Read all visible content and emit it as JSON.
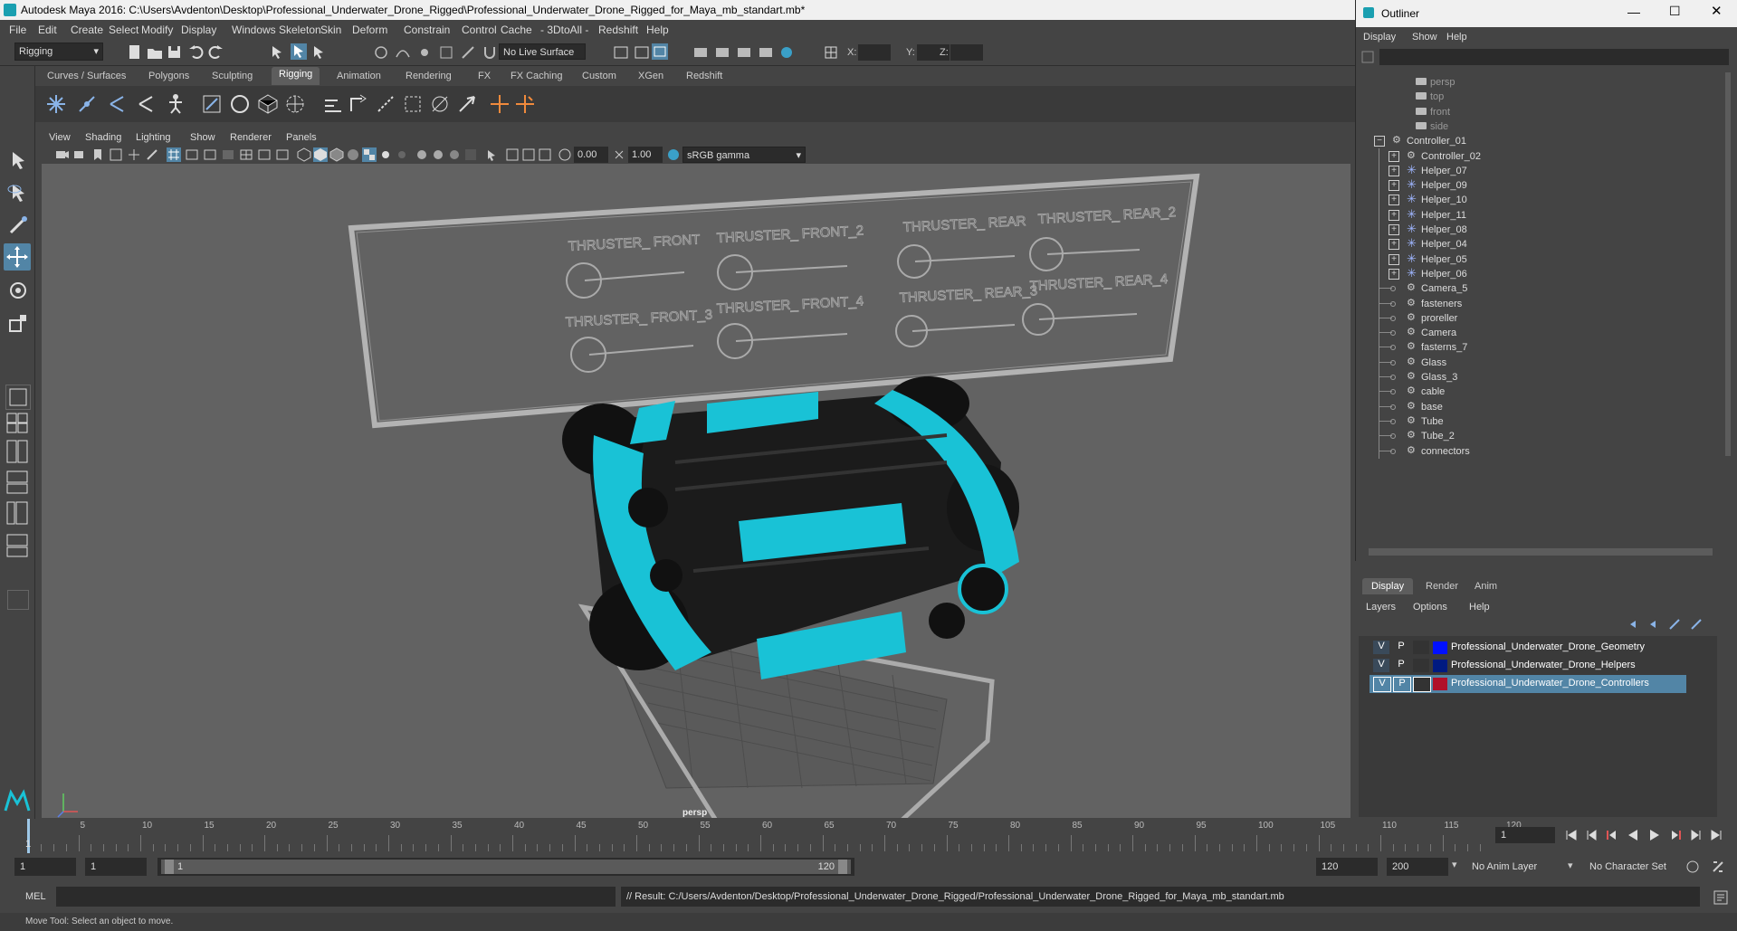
{
  "window": {
    "title": "Autodesk Maya 2016: C:\\Users\\Avdenton\\Desktop\\Professional_Underwater_Drone_Rigged\\Professional_Underwater_Drone_Rigged_for_Maya_mb_standart.mb*"
  },
  "menubar": [
    "File",
    "Edit",
    "Create",
    "Select",
    "Modify",
    "Display",
    "Windows",
    "Skeleton",
    "Skin",
    "Deform",
    "Constrain",
    "Control",
    "Cache",
    "- 3DtoAll -",
    "Redshift",
    "Help"
  ],
  "statusline": {
    "mode": "Rigging",
    "live_surface": "No Live Surface",
    "x_label": "X:",
    "y_label": "Y:",
    "z_label": "Z:"
  },
  "shelf_tabs": [
    "Curves / Surfaces",
    "Polygons",
    "Sculpting",
    "Rigging",
    "Animation",
    "Rendering",
    "FX",
    "FX Caching",
    "Custom",
    "XGen",
    "Redshift"
  ],
  "active_shelf": "Rigging",
  "viewport": {
    "menu": [
      "View",
      "Shading",
      "Lighting",
      "Show",
      "Renderer",
      "Panels"
    ],
    "exposure": "0.00",
    "gamma": "1.00",
    "color_space": "sRGB gamma",
    "camera_label": "persp",
    "controller_labels": [
      "THRUSTER_ FRONT",
      "THRUSTER_ FRONT_2",
      "THRUSTER_ REAR",
      "THRUSTER_ REAR_2",
      "THRUSTER_ FRONT_3",
      "THRUSTER_ FRONT_4",
      "THRUSTER_ REAR_3",
      "THRUSTER_ REAR_4"
    ]
  },
  "outliner": {
    "title": "Outliner",
    "menu": [
      "Display",
      "Show",
      "Help"
    ],
    "cameras": [
      "persp",
      "top",
      "front",
      "side"
    ],
    "root": "Controller_01",
    "children": [
      {
        "name": "Controller_02",
        "type": "curve",
        "expand": true
      },
      {
        "name": "Helper_07",
        "type": "helper",
        "expand": true
      },
      {
        "name": "Helper_09",
        "type": "helper",
        "expand": true
      },
      {
        "name": "Helper_10",
        "type": "helper",
        "expand": true
      },
      {
        "name": "Helper_11",
        "type": "helper",
        "expand": true
      },
      {
        "name": "Helper_08",
        "type": "helper",
        "expand": true
      },
      {
        "name": "Helper_04",
        "type": "helper",
        "expand": true
      },
      {
        "name": "Helper_05",
        "type": "helper",
        "expand": true
      },
      {
        "name": "Helper_06",
        "type": "helper",
        "expand": true
      },
      {
        "name": "Camera_5",
        "type": "curve",
        "expand": false
      },
      {
        "name": "fasteners",
        "type": "curve",
        "expand": false
      },
      {
        "name": "proreller",
        "type": "curve",
        "expand": false
      },
      {
        "name": "Camera",
        "type": "curve",
        "expand": false
      },
      {
        "name": "fasterns_7",
        "type": "curve",
        "expand": false
      },
      {
        "name": "Glass",
        "type": "curve",
        "expand": false
      },
      {
        "name": "Glass_3",
        "type": "curve",
        "expand": false
      },
      {
        "name": "cable",
        "type": "curve",
        "expand": false
      },
      {
        "name": "base",
        "type": "curve",
        "expand": false
      },
      {
        "name": "Tube",
        "type": "curve",
        "expand": false
      },
      {
        "name": "Tube_2",
        "type": "curve",
        "expand": false
      },
      {
        "name": "connectors",
        "type": "curve",
        "expand": false
      }
    ]
  },
  "layer_editor": {
    "tabs": [
      "Display",
      "Render",
      "Anim"
    ],
    "menu": [
      "Layers",
      "Options",
      "Help"
    ],
    "layers": [
      {
        "v": "V",
        "p": "P",
        "name": "Professional_Underwater_Drone_Geometry",
        "color": "#0010ff",
        "selected": false
      },
      {
        "v": "V",
        "p": "P",
        "name": "Professional_Underwater_Drone_Helpers",
        "color": "#001a80",
        "selected": false
      },
      {
        "v": "V",
        "p": "P",
        "name": "Professional_Underwater_Drone_Controllers",
        "color": "#b0102a",
        "selected": true
      }
    ]
  },
  "timeline": {
    "ticks": [
      "5",
      "10",
      "15",
      "20",
      "25",
      "30",
      "35",
      "40",
      "45",
      "50",
      "55",
      "60",
      "65",
      "70",
      "75",
      "80",
      "85",
      "90",
      "95",
      "100",
      "105",
      "110",
      "115",
      "120"
    ],
    "start_marker": "1",
    "current_frame": "1"
  },
  "range": {
    "start": "1",
    "playback_start": "1",
    "range_left": "1",
    "range_right": "120",
    "playback_end": "120",
    "end": "200",
    "anim_layer": "No Anim Layer",
    "character_set": "No Character Set"
  },
  "cmd": {
    "lang": "MEL",
    "result": "// Result: C:/Users/Avdenton/Desktop/Professional_Underwater_Drone_Rigged/Professional_Underwater_Drone_Rigged_for_Maya_mb_standart.mb"
  },
  "help_line": "Move Tool: Select an object to move.",
  "colors": {
    "accent": "#19c2d6",
    "selected_row": "#5285a6",
    "active_tool": "#5285a6"
  }
}
